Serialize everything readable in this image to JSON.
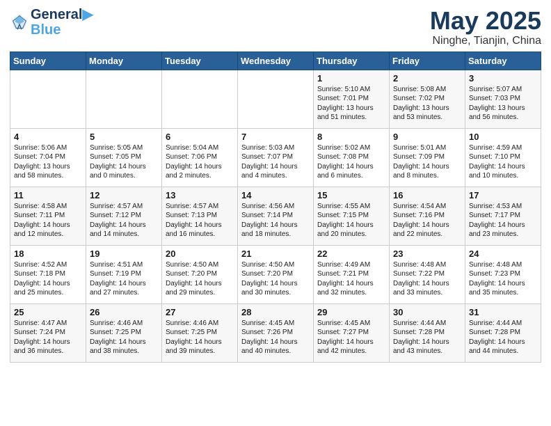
{
  "header": {
    "logo_line1": "General",
    "logo_line2": "Blue",
    "month_year": "May 2025",
    "location": "Ninghe, Tianjin, China"
  },
  "weekdays": [
    "Sunday",
    "Monday",
    "Tuesday",
    "Wednesday",
    "Thursday",
    "Friday",
    "Saturday"
  ],
  "weeks": [
    [
      {
        "day": "",
        "text": ""
      },
      {
        "day": "",
        "text": ""
      },
      {
        "day": "",
        "text": ""
      },
      {
        "day": "",
        "text": ""
      },
      {
        "day": "1",
        "text": "Sunrise: 5:10 AM\nSunset: 7:01 PM\nDaylight: 13 hours\nand 51 minutes."
      },
      {
        "day": "2",
        "text": "Sunrise: 5:08 AM\nSunset: 7:02 PM\nDaylight: 13 hours\nand 53 minutes."
      },
      {
        "day": "3",
        "text": "Sunrise: 5:07 AM\nSunset: 7:03 PM\nDaylight: 13 hours\nand 56 minutes."
      }
    ],
    [
      {
        "day": "4",
        "text": "Sunrise: 5:06 AM\nSunset: 7:04 PM\nDaylight: 13 hours\nand 58 minutes."
      },
      {
        "day": "5",
        "text": "Sunrise: 5:05 AM\nSunset: 7:05 PM\nDaylight: 14 hours\nand 0 minutes."
      },
      {
        "day": "6",
        "text": "Sunrise: 5:04 AM\nSunset: 7:06 PM\nDaylight: 14 hours\nand 2 minutes."
      },
      {
        "day": "7",
        "text": "Sunrise: 5:03 AM\nSunset: 7:07 PM\nDaylight: 14 hours\nand 4 minutes."
      },
      {
        "day": "8",
        "text": "Sunrise: 5:02 AM\nSunset: 7:08 PM\nDaylight: 14 hours\nand 6 minutes."
      },
      {
        "day": "9",
        "text": "Sunrise: 5:01 AM\nSunset: 7:09 PM\nDaylight: 14 hours\nand 8 minutes."
      },
      {
        "day": "10",
        "text": "Sunrise: 4:59 AM\nSunset: 7:10 PM\nDaylight: 14 hours\nand 10 minutes."
      }
    ],
    [
      {
        "day": "11",
        "text": "Sunrise: 4:58 AM\nSunset: 7:11 PM\nDaylight: 14 hours\nand 12 minutes."
      },
      {
        "day": "12",
        "text": "Sunrise: 4:57 AM\nSunset: 7:12 PM\nDaylight: 14 hours\nand 14 minutes."
      },
      {
        "day": "13",
        "text": "Sunrise: 4:57 AM\nSunset: 7:13 PM\nDaylight: 14 hours\nand 16 minutes."
      },
      {
        "day": "14",
        "text": "Sunrise: 4:56 AM\nSunset: 7:14 PM\nDaylight: 14 hours\nand 18 minutes."
      },
      {
        "day": "15",
        "text": "Sunrise: 4:55 AM\nSunset: 7:15 PM\nDaylight: 14 hours\nand 20 minutes."
      },
      {
        "day": "16",
        "text": "Sunrise: 4:54 AM\nSunset: 7:16 PM\nDaylight: 14 hours\nand 22 minutes."
      },
      {
        "day": "17",
        "text": "Sunrise: 4:53 AM\nSunset: 7:17 PM\nDaylight: 14 hours\nand 23 minutes."
      }
    ],
    [
      {
        "day": "18",
        "text": "Sunrise: 4:52 AM\nSunset: 7:18 PM\nDaylight: 14 hours\nand 25 minutes."
      },
      {
        "day": "19",
        "text": "Sunrise: 4:51 AM\nSunset: 7:19 PM\nDaylight: 14 hours\nand 27 minutes."
      },
      {
        "day": "20",
        "text": "Sunrise: 4:50 AM\nSunset: 7:20 PM\nDaylight: 14 hours\nand 29 minutes."
      },
      {
        "day": "21",
        "text": "Sunrise: 4:50 AM\nSunset: 7:20 PM\nDaylight: 14 hours\nand 30 minutes."
      },
      {
        "day": "22",
        "text": "Sunrise: 4:49 AM\nSunset: 7:21 PM\nDaylight: 14 hours\nand 32 minutes."
      },
      {
        "day": "23",
        "text": "Sunrise: 4:48 AM\nSunset: 7:22 PM\nDaylight: 14 hours\nand 33 minutes."
      },
      {
        "day": "24",
        "text": "Sunrise: 4:48 AM\nSunset: 7:23 PM\nDaylight: 14 hours\nand 35 minutes."
      }
    ],
    [
      {
        "day": "25",
        "text": "Sunrise: 4:47 AM\nSunset: 7:24 PM\nDaylight: 14 hours\nand 36 minutes."
      },
      {
        "day": "26",
        "text": "Sunrise: 4:46 AM\nSunset: 7:25 PM\nDaylight: 14 hours\nand 38 minutes."
      },
      {
        "day": "27",
        "text": "Sunrise: 4:46 AM\nSunset: 7:25 PM\nDaylight: 14 hours\nand 39 minutes."
      },
      {
        "day": "28",
        "text": "Sunrise: 4:45 AM\nSunset: 7:26 PM\nDaylight: 14 hours\nand 40 minutes."
      },
      {
        "day": "29",
        "text": "Sunrise: 4:45 AM\nSunset: 7:27 PM\nDaylight: 14 hours\nand 42 minutes."
      },
      {
        "day": "30",
        "text": "Sunrise: 4:44 AM\nSunset: 7:28 PM\nDaylight: 14 hours\nand 43 minutes."
      },
      {
        "day": "31",
        "text": "Sunrise: 4:44 AM\nSunset: 7:28 PM\nDaylight: 14 hours\nand 44 minutes."
      }
    ]
  ]
}
